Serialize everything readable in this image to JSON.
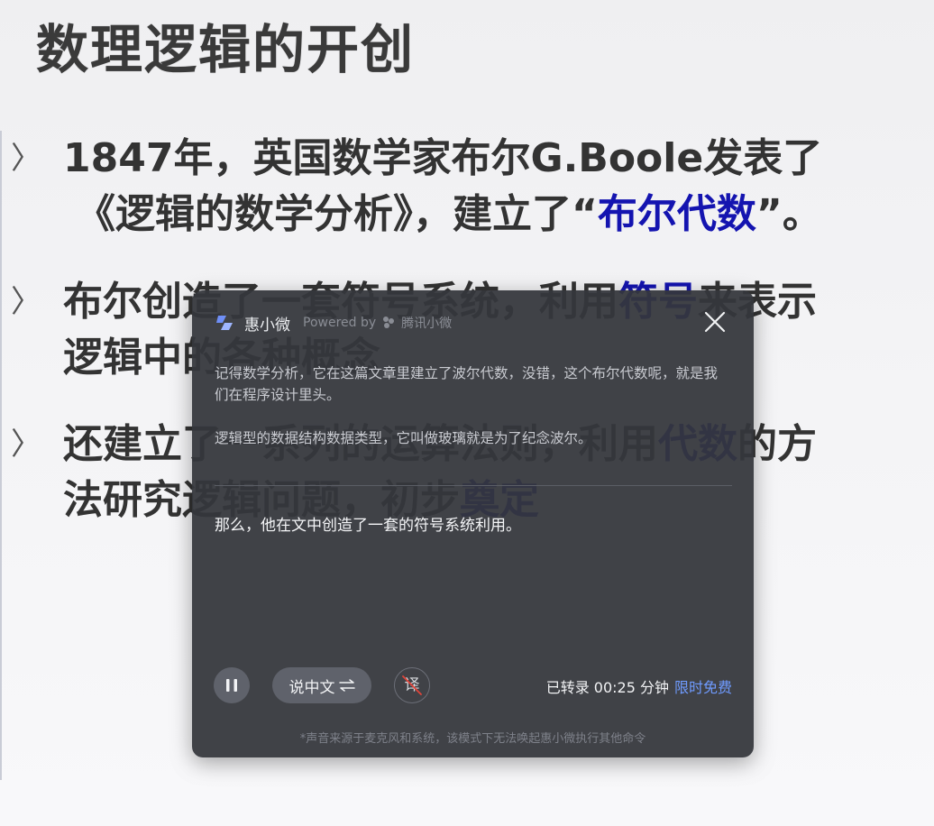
{
  "slide": {
    "title": "数理逻辑的开创",
    "bullet_marker": "〉",
    "bullets": [
      {
        "line1": "1847年，英国数学家布尔G.Boole发表了",
        "line2_pre": "《逻辑的数学分析》，建立了“",
        "line2_hl": "布尔代数",
        "line2_post": "”。"
      },
      {
        "line1_pre": "布尔创造了一套符号系统，利用",
        "line1_hl": "符号",
        "line1_post": "来表示",
        "line2": "逻辑中的各种概念"
      },
      {
        "line1_pre": "还建立了一系列的运算法则，利用",
        "line1_hl": "代数",
        "line1_post": "的方",
        "line2_pre": "法研究逻辑问题，初步",
        "line2_hl": "奠定"
      }
    ],
    "colors": {
      "highlight": "#1414b0",
      "text": "#333333"
    }
  },
  "panel": {
    "app_name": "惠小微",
    "powered_by": "Powered by",
    "provider": "腾讯小微",
    "close_icon": "close-icon",
    "transcript": [
      "记得数学分析，它在这篇文章里建立了波尔代数，没错，这个布尔代数呢，就是我们在程序设计里头。",
      "逻辑型的数据结构数据类型，它叫做玻璃就是为了纪念波尔。"
    ],
    "current_line": "那么，他在文中创造了一套的符号系统利用。",
    "controls": {
      "pause_icon": "pause-icon",
      "lang_label": "说中文",
      "swap_icon": "swap-icon",
      "translate_label": "译",
      "status_label": "已转录 00:25 分钟",
      "free_label": "限时免费"
    },
    "footnote": "*声音来源于麦克风和系统，该模式下无法唤起惠小微执行其他命令",
    "colors": {
      "background": "#34363c",
      "accent": "#6f9bff"
    }
  }
}
